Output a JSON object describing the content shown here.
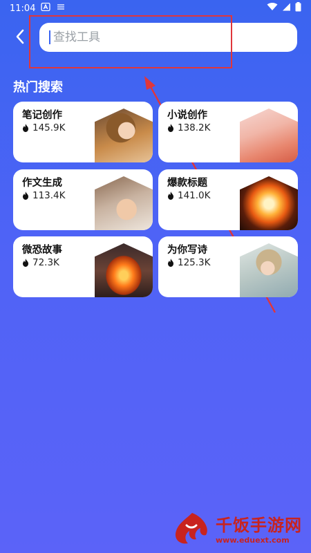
{
  "status_bar": {
    "time": "11:04",
    "icons": [
      "notification-a-icon",
      "usb-icon",
      "wifi-icon",
      "signal-icon",
      "battery-icon"
    ]
  },
  "header": {
    "back_icon": "chevron-left-icon",
    "search": {
      "value": "",
      "placeholder": "查找工具"
    }
  },
  "section": {
    "title": "热门搜索"
  },
  "cards": [
    {
      "title": "笔记创作",
      "count": "145.9K",
      "thumb": "portrait-woman-thumb"
    },
    {
      "title": "小说创作",
      "count": "138.2K",
      "thumb": "pen-paper-thumb"
    },
    {
      "title": "作文生成",
      "count": "113.4K",
      "thumb": "writing-hand-thumb"
    },
    {
      "title": "爆款标题",
      "count": "141.0K",
      "thumb": "explosion-thumb"
    },
    {
      "title": "微恐故事",
      "count": "72.3K",
      "thumb": "pumpkin-robot-thumb"
    },
    {
      "title": "为你写诗",
      "count": "125.3K",
      "thumb": "anime-boy-thumb"
    }
  ],
  "colors": {
    "background_top": "#3a64f0",
    "background_bottom": "#5b63f8",
    "highlight": "#e0363a",
    "watermark": "#c8231f"
  },
  "watermark": {
    "name": "千饭手游网",
    "url": "www.eduext.com"
  }
}
